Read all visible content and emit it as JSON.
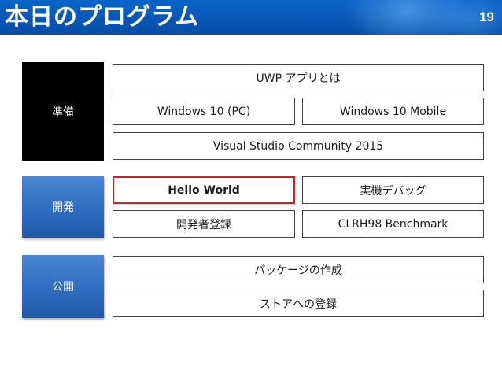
{
  "header": {
    "title": "本日のプログラム",
    "page_number": "19"
  },
  "sections": [
    {
      "label": "準備",
      "items": [
        "UWP アプリとは",
        "Windows 10 (PC)",
        "Windows 10 Mobile",
        "Visual Studio Community 2015"
      ]
    },
    {
      "label": "開発",
      "items": [
        "Hello World",
        "実機デバッグ",
        "開発者登録",
        "CLRH98 Benchmark"
      ]
    },
    {
      "label": "公開",
      "items": [
        "パッケージの作成",
        "ストアへの登録"
      ]
    }
  ],
  "colors": {
    "header": "#0a55b4",
    "label_black": "#000000",
    "label_blue": "#2f6cc0",
    "highlight_border": "#d42020"
  }
}
